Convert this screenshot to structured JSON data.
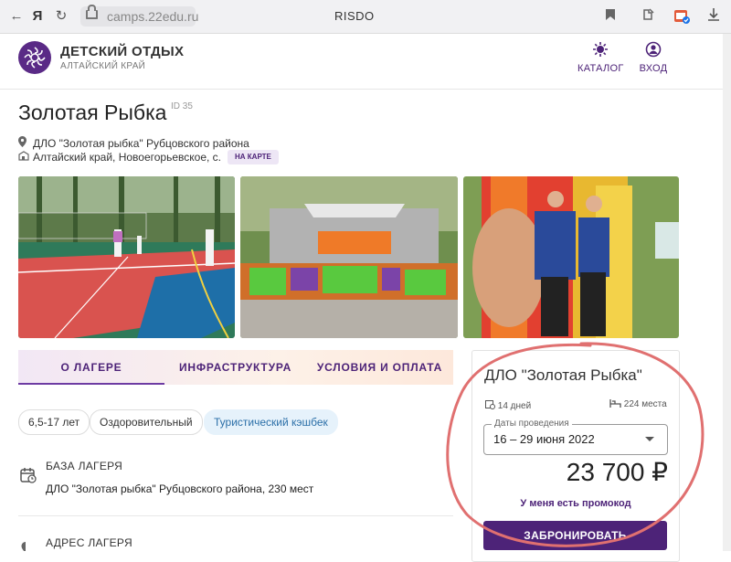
{
  "browser": {
    "browser_logo_glyph": "Я",
    "url": "camps.22edu.ru",
    "tab_title": "RISDO"
  },
  "site": {
    "title": "ДЕТСКИЙ ОТДЫХ",
    "subtitle": "АЛТАЙСКИЙ КРАЙ",
    "nav": [
      {
        "label": "КАТАЛОГ",
        "icon": "catalog-icon"
      },
      {
        "label": "ВХОД",
        "icon": "user-icon"
      }
    ],
    "brand_color": "#4d2378"
  },
  "camp": {
    "name": "Золотая Рыбка",
    "id_label": "ID 35",
    "organization": "ДЛО \"Золотая рыбка\" Рубцовского района",
    "location": "Алтайский край, Новоегорьевское, с.",
    "map_chip": "НА КАРТЕ"
  },
  "tabs": [
    {
      "label": "О ЛАГЕРЕ",
      "active": true
    },
    {
      "label": "ИНФРАСТРУКТУРА",
      "active": false
    },
    {
      "label": "УСЛОВИЯ И ОПЛАТА",
      "active": false
    }
  ],
  "chips": [
    {
      "label": "6,5-17 лет"
    },
    {
      "label": "Оздоровительный"
    },
    {
      "label": "Туристический кэшбек"
    }
  ],
  "sections": [
    {
      "title": "БАЗА ЛАГЕРЯ",
      "text": "ДЛО \"Золотая рыбка\" Рубцовского района, 230 мест",
      "icon": "calendar-icon"
    },
    {
      "title": "АДРЕС ЛАГЕРЯ",
      "icon": "pin-icon"
    }
  ],
  "booking": {
    "title": "ДЛО \"Золотая Рыбка\"",
    "duration": "14 дней",
    "capacity": "224 места",
    "dates_label": "Даты проведения",
    "dates_value": "16 – 29 июня 2022",
    "price": "23 700 ₽",
    "promo": "У меня есть промокод",
    "book_button": "ЗАБРОНИРОВАТЬ"
  }
}
